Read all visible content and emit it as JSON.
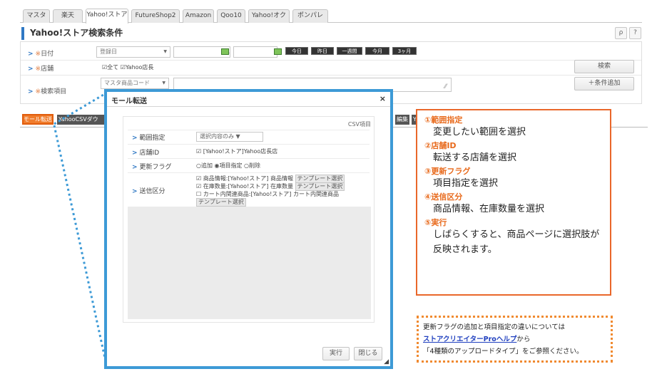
{
  "tabs": [
    "マスタ",
    "楽天",
    "Yahoo!ストア",
    "FutureShop2",
    "Amazon",
    "Qoo10",
    "Yahoo!オク",
    "ポンパレ"
  ],
  "panel": {
    "title": "Yahoo!ストア検索条件"
  },
  "icons": {
    "search": "search-icon",
    "help": "help-icon"
  },
  "tool_buttons": {
    "search_glyph": "ρ",
    "help_glyph": "?"
  },
  "form": {
    "date_label": "日付",
    "date_field": "登録日",
    "date_separator": "～",
    "date_buttons": [
      "今日",
      "昨日",
      "一週間",
      "今月",
      "3ヶ月"
    ],
    "store_label": "店舗",
    "store_checks": "☑全て ☑Yahoo店長",
    "keyword_label": "検索項目",
    "keyword_field": "マスタ商品コード",
    "required_mark": "※",
    "search_button": "検索",
    "add_condition_button": "＋条件追加"
  },
  "toolbar": {
    "mall_transfer": "モール転送",
    "csv_download": "YahooCSVダウン",
    "edit": "編集",
    "edit_partial": "Y"
  },
  "modal": {
    "title": "モール転送",
    "close": "×",
    "csv_label": "CSV項目",
    "range_label": "範囲指定",
    "range_value": "選択内容のみ",
    "store_id_label": "店舗ID",
    "store_id_value": "☑ [Yahoo!ストア]Yahoo店長店",
    "flag_label": "更新フラグ",
    "flag_value": "○追加 ◉項目指定 ○削除",
    "send_label": "送信区分",
    "send_line1": "☑ 商品情報:[Yahoo!ストア] 商品情報",
    "send_line2": "☑ 在庫数量:[Yahoo!ストア] 在庫数量",
    "send_line3": "☐ カート内関連商品:[Yahoo!ストア] カート内関連商品",
    "template_button": "テンプレート選択",
    "execute_button": "実行",
    "close_button": "閉じる"
  },
  "annotation": {
    "steps": [
      {
        "heading": "①範囲指定",
        "text": "変更したい範囲を選択"
      },
      {
        "heading": "②店舗ID",
        "text": "転送する店舗を選択"
      },
      {
        "heading": "③更新フラグ",
        "text": "項目指定を選択"
      },
      {
        "heading": "④送信区分",
        "text": "商品情報、在庫数量を選択"
      },
      {
        "heading": "⑤実行",
        "text": "しばらくすると、商品ページに選択肢が"
      }
    ],
    "last_line": "反映されます。"
  },
  "info": {
    "line1": "更新フラグの追加と項目指定の違いについては",
    "link": "ストアクリエイターProヘルプ",
    "line2_suffix": "から",
    "line3": "「4種類のアップロードタイプ」をご参照ください。"
  },
  "colors": {
    "accent_orange": "#e9672a",
    "modal_border": "#3d9ad6",
    "link": "#1f3fbf"
  }
}
